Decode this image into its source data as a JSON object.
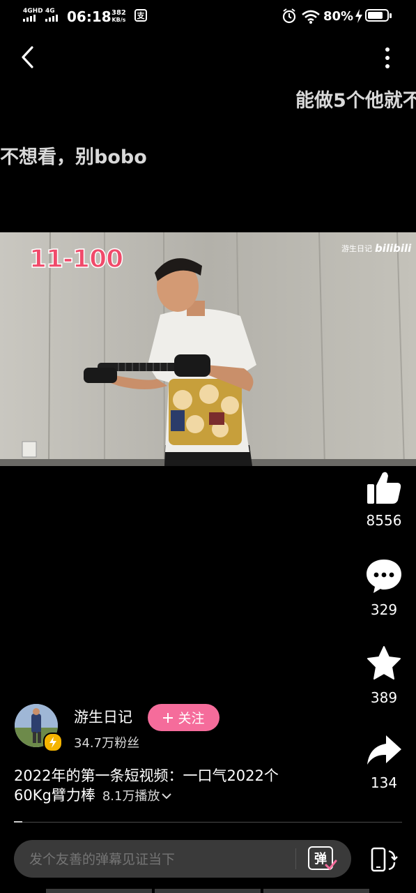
{
  "status": {
    "network1": "4GHD",
    "network2": "4G",
    "time": "06:18",
    "speed_value": "382",
    "speed_unit": "KB/s",
    "battery": "80%"
  },
  "danmaku": [
    "能做5个他就不",
    "不想看，别bobo"
  ],
  "video": {
    "counter": "11-100",
    "watermark_text": "游生日记",
    "watermark_logo": "bilibili"
  },
  "actions": {
    "likes": "8556",
    "comments": "329",
    "favorites": "389",
    "shares": "134"
  },
  "author": {
    "name": "游生日记",
    "follow_label": "关注",
    "fans": "34.7万粉丝"
  },
  "title": {
    "line1": "2022年的第一条短视频：一口气2022个",
    "line2": "60Kg臂力棒",
    "plays": "8.1万播放"
  },
  "comment_input": {
    "placeholder": "发个友善的弹幕见证当下",
    "danmaku_toggle_label": "弹"
  }
}
